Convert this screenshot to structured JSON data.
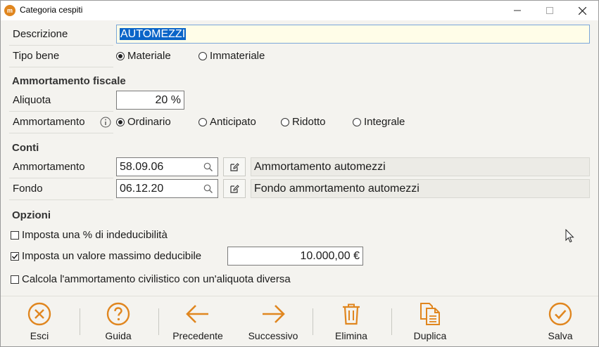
{
  "window": {
    "title": "Categoria cespiti",
    "app_icon_text": "m"
  },
  "descrizione": {
    "label": "Descrizione",
    "value": "AUTOMEZZI"
  },
  "tipo_bene": {
    "label": "Tipo bene",
    "options": [
      "Materiale",
      "Immateriale"
    ],
    "selected": "Materiale"
  },
  "ammortamento_fiscale": {
    "title": "Ammortamento fiscale",
    "aliquota_label": "Aliquota",
    "aliquota_value": "20 %",
    "ammortamento_label": "Ammortamento",
    "options": [
      "Ordinario",
      "Anticipato",
      "Ridotto",
      "Integrale"
    ],
    "selected": "Ordinario"
  },
  "conti": {
    "title": "Conti",
    "rows": [
      {
        "label": "Ammortamento",
        "code": "58.09.06",
        "description": "Ammortamento automezzi"
      },
      {
        "label": "Fondo",
        "code": "06.12.20",
        "description": "Fondo ammortamento automezzi"
      }
    ]
  },
  "opzioni": {
    "title": "Opzioni",
    "indeducibilita_label": "Imposta una % di indeducibilità",
    "indeducibilita_checked": false,
    "massimo_label": "Imposta un valore massimo deducibile",
    "massimo_checked": true,
    "massimo_value": "10.000,00 €",
    "civilistico_label": "Calcola l'ammortamento civilistico con un'aliquota diversa",
    "civilistico_checked": false
  },
  "toolbar": {
    "esci": "Esci",
    "guida": "Guida",
    "precedente": "Precedente",
    "successivo": "Successivo",
    "elimina": "Elimina",
    "duplica": "Duplica",
    "salva": "Salva"
  },
  "colors": {
    "accent": "#e0861f",
    "selection": "#0a64c8",
    "field_bg": "#fffde8"
  }
}
